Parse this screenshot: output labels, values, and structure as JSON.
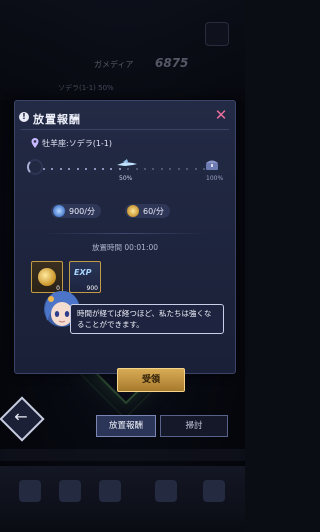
{
  "background": {
    "player_name": "ガメディア",
    "score": "6875",
    "sub_info": "ソデラ(1-1)  50%"
  },
  "dialog": {
    "title": "放置報酬",
    "stage": "牡羊座:ソデラ(1-1)",
    "progress_fraction": 0.5,
    "progress_mid_label": "50%",
    "progress_end_label": "100%",
    "rates": [
      {
        "icon": "exp-icon",
        "label": "900/分"
      },
      {
        "icon": "coin-icon",
        "label": "60/分"
      }
    ],
    "idle_time": "放置時間 00:01:00",
    "rewards": [
      {
        "icon": "coin-icon",
        "count": "0"
      },
      {
        "icon": "exp-icon",
        "name": "EXP",
        "count": "900"
      }
    ],
    "speech": "時間が経てば経つほど、私たちは強くなることができます。",
    "receive_label": "受領"
  },
  "tabs": [
    {
      "label": "放置報酬",
      "active": true
    },
    {
      "label": "掃討",
      "active": false
    }
  ],
  "colors": {
    "accent_gold": "#c49b45",
    "close_pink": "#e8709b",
    "panel": "#1f2540"
  }
}
